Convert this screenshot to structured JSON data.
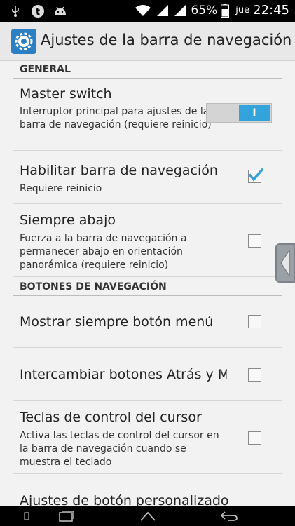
{
  "status_bar": {
    "battery_percent": "65%",
    "day": "jue",
    "time": "22:45"
  },
  "action_bar": {
    "title": "Ajustes de la barra de navegación"
  },
  "sections": {
    "general": {
      "header": "GENERAL"
    },
    "nav_buttons": {
      "header": "BOTONES DE NAVEGACIÓN"
    }
  },
  "prefs": {
    "master_switch": {
      "title": "Master switch",
      "summary": "Interruptor principal para ajustes de la barra de navegación (requiere reinicio)",
      "state_label": "I"
    },
    "enable_navbar": {
      "title": "Habilitar barra de navegación",
      "summary": "Requiere reinicio",
      "checked": true
    },
    "always_down": {
      "title": "Siempre abajo",
      "summary": "Fuerza a la barra de navegación a permanecer abajo en orientación panorámica (requiere reinicio)",
      "checked": false
    },
    "show_menu": {
      "title": "Mostrar siempre botón menú",
      "checked": false
    },
    "swap_buttons": {
      "title": "Intercambiar botones Atrás y M",
      "checked": false
    },
    "cursor_keys": {
      "title": "Teclas de control del cursor",
      "summary": "Activa las teclas de control del cursor en la barra de navegación cuando se muestra el teclado",
      "checked": false
    },
    "custom_button": {
      "title": "Ajustes de botón personalizado"
    }
  },
  "colors": {
    "accent": "#33a3dc",
    "check": "#33a3dc"
  }
}
